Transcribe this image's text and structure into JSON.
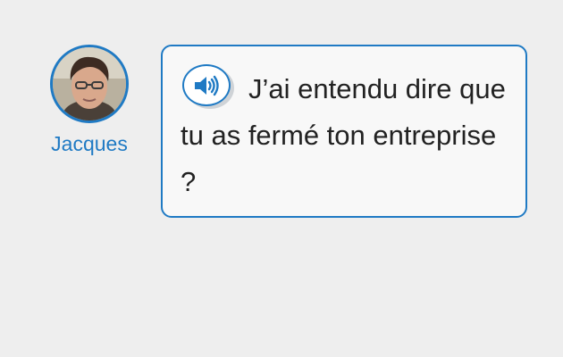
{
  "speaker": {
    "name": "Jacques"
  },
  "bubble": {
    "text": "J’ai entendu dire que tu as fermé ton entreprise ?"
  },
  "icons": {
    "audio": "speaker-icon",
    "avatar": "avatar-photo"
  },
  "colors": {
    "accent": "#1f7ac4",
    "background": "#eeeeee",
    "bubble_fill": "#f8f8f8",
    "text": "#222222"
  }
}
